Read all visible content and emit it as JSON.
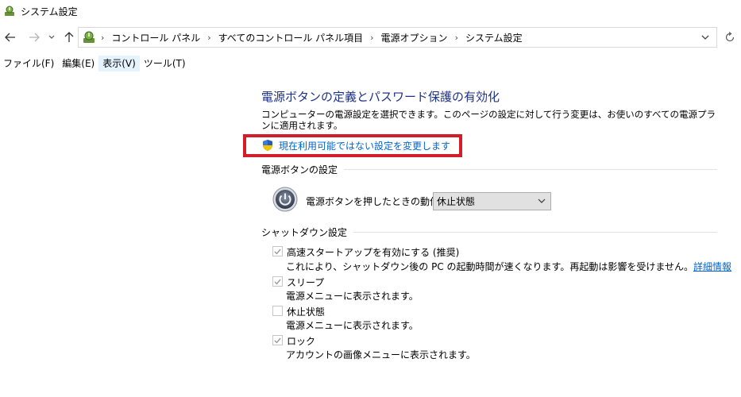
{
  "window": {
    "title": "システム設定"
  },
  "nav": {
    "back_icon": "arrow-left-icon",
    "forward_icon": "arrow-right-icon",
    "recent_icon": "chevron-down-icon",
    "up_icon": "arrow-up-icon",
    "refresh_icon": "refresh-icon"
  },
  "address": {
    "crumbs": [
      "コントロール パネル",
      "すべてのコントロール パネル項目",
      "電源オプション",
      "システム設定"
    ]
  },
  "menu": {
    "file": "ファイル(F)",
    "edit": "編集(E)",
    "view": "表示(V)",
    "tools": "ツール(T)"
  },
  "main": {
    "heading": "電源ボタンの定義とパスワード保護の有効化",
    "description": "コンピューターの電源設定を選択できます。このページの設定に対して行う変更は、お使いのすべての電源プランに適用されます。",
    "change_link": "現在利用可能ではない設定を変更します",
    "power_section": "電源ボタンの設定",
    "power_action_label": "電源ボタンを押したときの動作:",
    "power_action_value": "休止状態",
    "shutdown_section": "シャットダウン設定",
    "options": [
      {
        "label": "高速スタートアップを有効にする (推奨)",
        "desc": "これにより、シャットダウン後の PC の起動時間が速くなります。再起動は影響を受けません。",
        "link": "詳細情報",
        "checked": true
      },
      {
        "label": "スリープ",
        "desc": "電源メニューに表示されます。",
        "checked": true
      },
      {
        "label": "休止状態",
        "desc": "電源メニューに表示されます。",
        "checked": false
      },
      {
        "label": "ロック",
        "desc": "アカウントの画像メニューに表示されます。",
        "checked": true
      }
    ]
  },
  "colors": {
    "heading": "#1e3287",
    "link": "#0066cc",
    "highlight_box": "#d21e2b"
  }
}
